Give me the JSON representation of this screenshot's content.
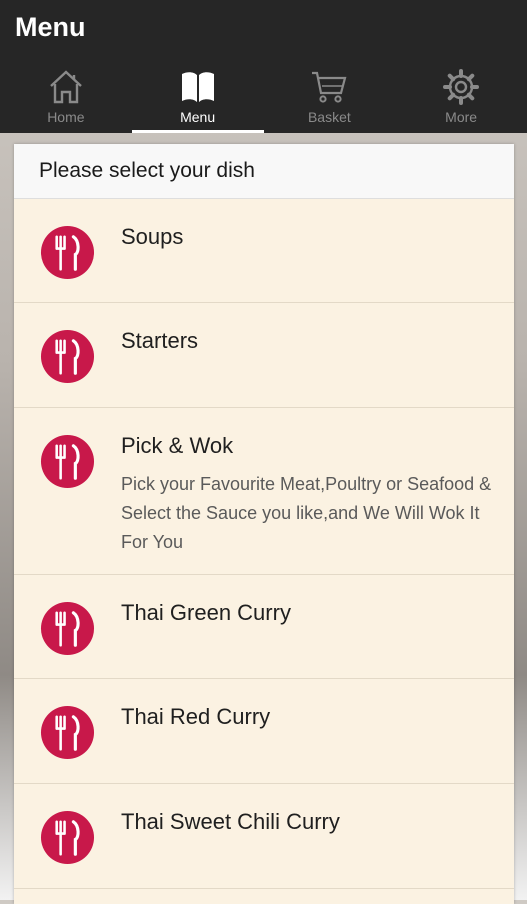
{
  "header": {
    "title": "Menu"
  },
  "tabs": [
    {
      "label": "Home",
      "icon": "home-icon"
    },
    {
      "label": "Menu",
      "icon": "book-icon"
    },
    {
      "label": "Basket",
      "icon": "cart-icon"
    },
    {
      "label": "More",
      "icon": "gear-icon"
    }
  ],
  "active_tab": "Menu",
  "section": {
    "title": "Please select your dish"
  },
  "items": [
    {
      "name": "Soups",
      "desc": ""
    },
    {
      "name": "Starters",
      "desc": ""
    },
    {
      "name": "Pick & Wok",
      "desc": "Pick your Favourite Meat,Poultry or Seafood & Select the Sauce you like,and We Will Wok It For You"
    },
    {
      "name": "Thai Green Curry",
      "desc": ""
    },
    {
      "name": "Thai Red Curry",
      "desc": ""
    },
    {
      "name": "Thai Sweet Chili Curry",
      "desc": ""
    }
  ],
  "colors": {
    "topbar": "#262626",
    "accent": "#c8184a",
    "card": "#fbf2e2"
  }
}
